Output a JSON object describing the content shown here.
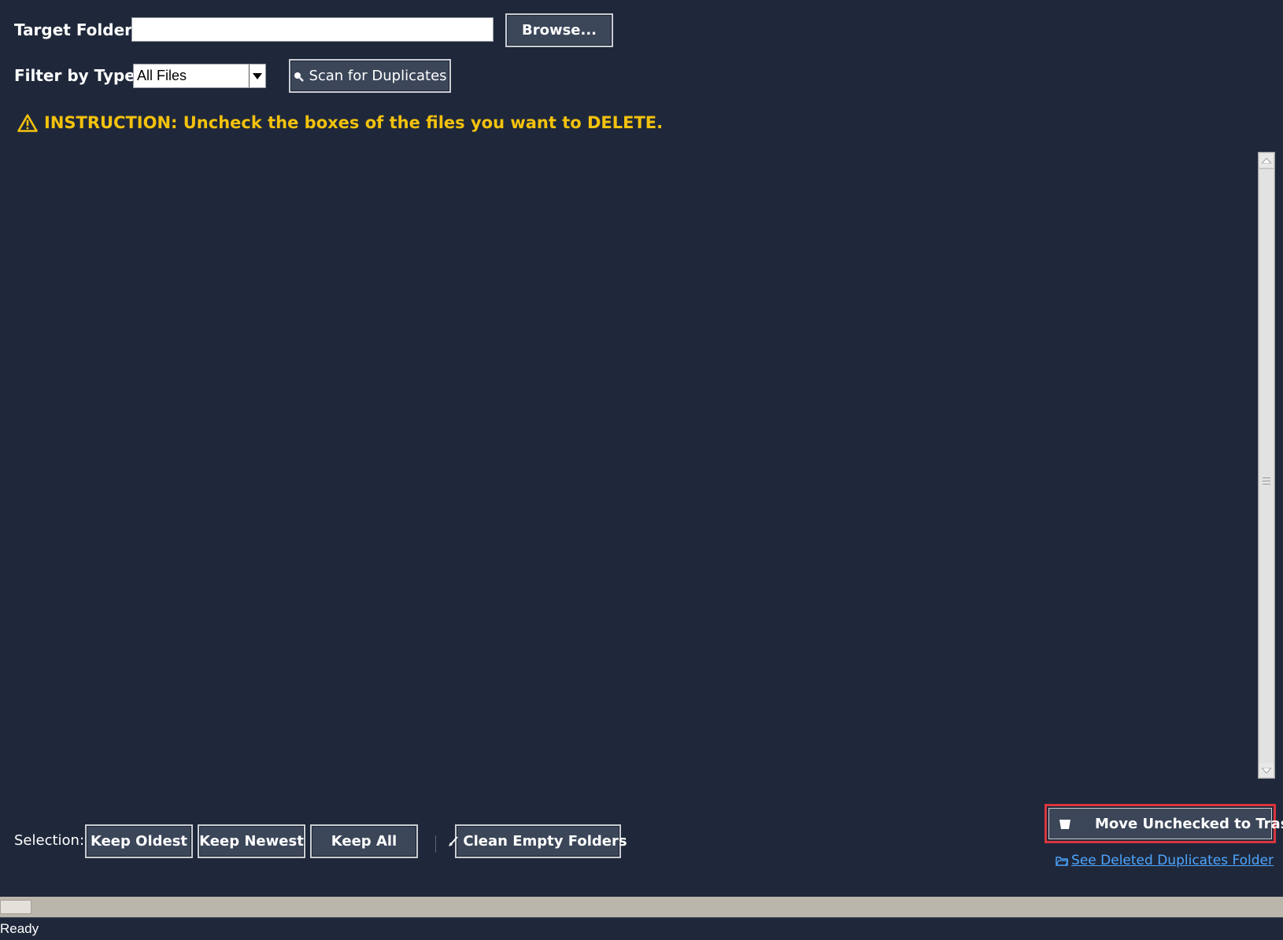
{
  "target_folder": {
    "label": "Target Folder:",
    "value": "",
    "browse_label": "Browse..."
  },
  "filter": {
    "label": "Filter by Type:",
    "selected": "All Files",
    "scan_label": "Scan for Duplicates"
  },
  "instruction": {
    "text": "INSTRUCTION: Uncheck the boxes of the files you want to DELETE.",
    "color": "#f4c20d"
  },
  "selection": {
    "label": "Selection:",
    "keep_oldest": "Keep Oldest",
    "keep_newest": "Keep Newest",
    "keep_all": "Keep All",
    "clean_empty": "Clean Empty Folders"
  },
  "actions": {
    "move_to_trash": "Move Unchecked to Trash",
    "see_deleted": "See Deleted Duplicates Folder",
    "highlight_color": "#d9363e"
  },
  "status": {
    "text": "Ready"
  },
  "icons": {
    "scan": "search-icon",
    "clean": "broom-icon",
    "trash": "trash-icon",
    "folder": "folder-icon",
    "warning": "warning-icon"
  }
}
